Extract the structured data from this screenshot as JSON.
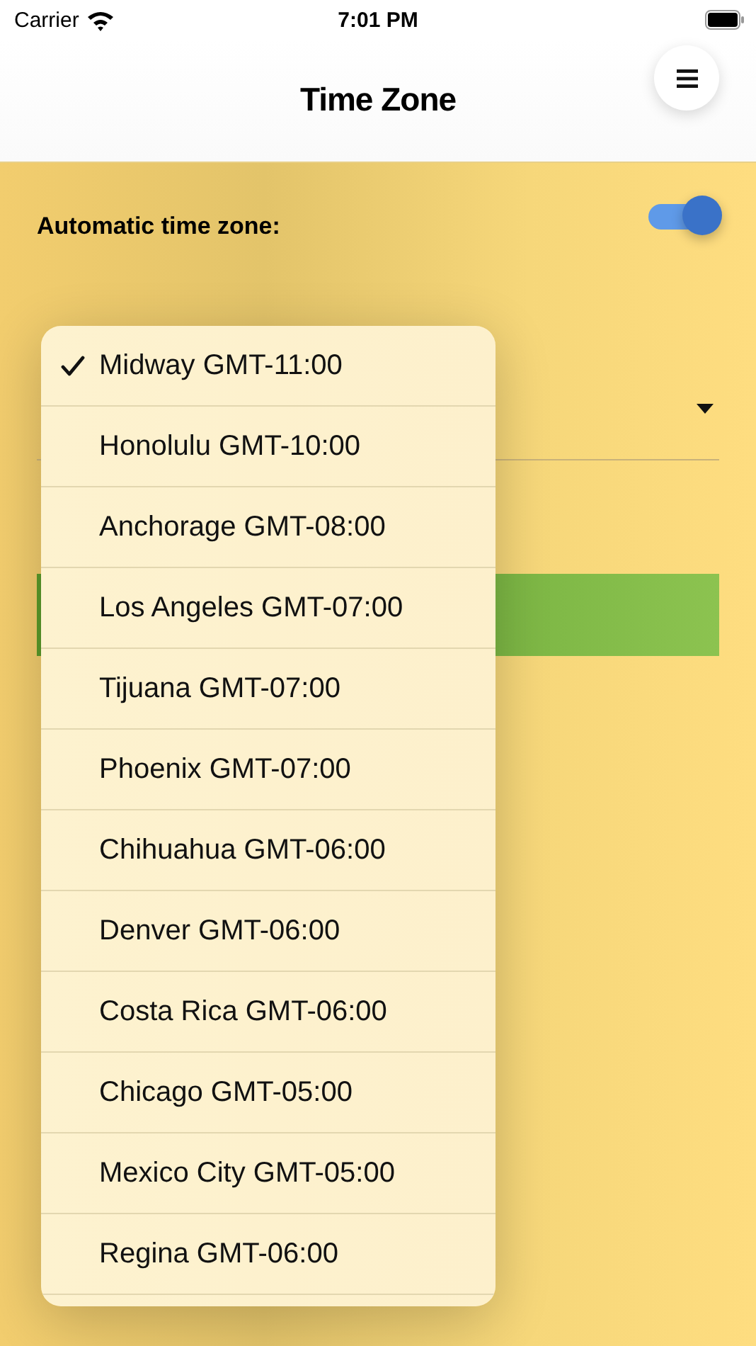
{
  "status_bar": {
    "carrier": "Carrier",
    "time": "7:01 PM"
  },
  "header": {
    "title": "Time Zone"
  },
  "automatic": {
    "label": "Automatic time zone:",
    "on": true
  },
  "menu": {
    "items": [
      {
        "label": "Midway GMT-11:00",
        "selected": true
      },
      {
        "label": "Honolulu GMT-10:00",
        "selected": false
      },
      {
        "label": "Anchorage GMT-08:00",
        "selected": false
      },
      {
        "label": "Los Angeles GMT-07:00",
        "selected": false
      },
      {
        "label": "Tijuana GMT-07:00",
        "selected": false
      },
      {
        "label": "Phoenix GMT-07:00",
        "selected": false
      },
      {
        "label": "Chihuahua GMT-06:00",
        "selected": false
      },
      {
        "label": "Denver GMT-06:00",
        "selected": false
      },
      {
        "label": "Costa Rica GMT-06:00",
        "selected": false
      },
      {
        "label": "Chicago GMT-05:00",
        "selected": false
      },
      {
        "label": "Mexico City GMT-05:00",
        "selected": false
      },
      {
        "label": "Regina GMT-06:00",
        "selected": false
      }
    ]
  }
}
